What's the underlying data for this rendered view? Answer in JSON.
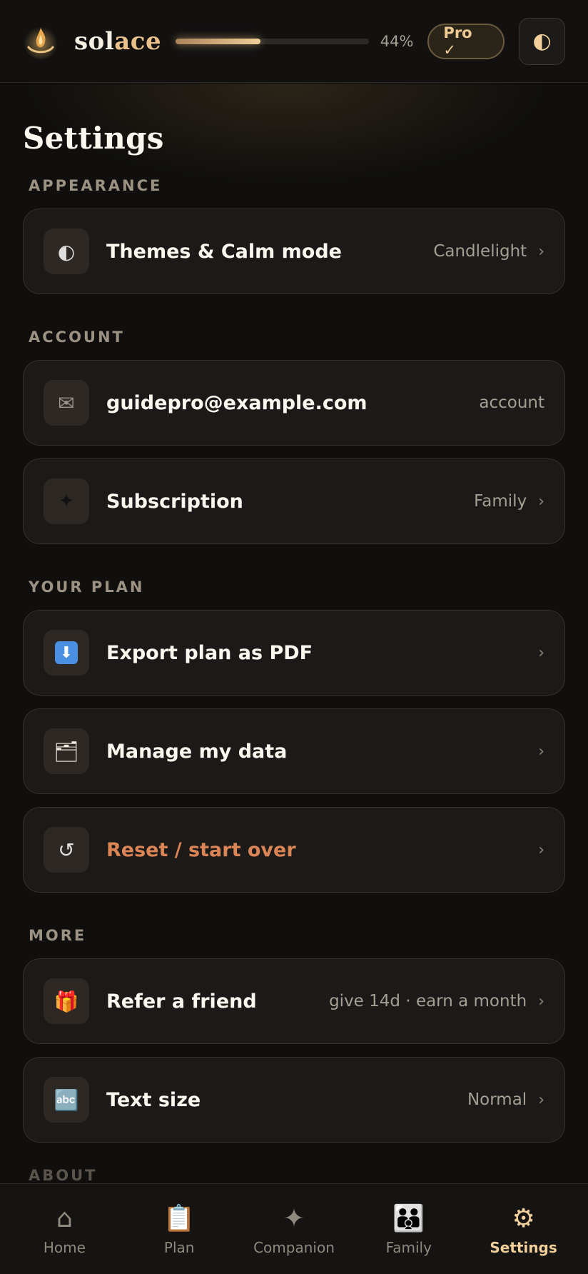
{
  "header": {
    "brand_prefix": "sol",
    "brand_suffix": "ace",
    "progress_percent": 44,
    "progress_text": "44%",
    "pro_label": "Pro ✓",
    "theme_icon": "◐",
    "colors": {
      "accent": "#f0cf9a",
      "background": "#100f0d"
    }
  },
  "page": {
    "title": "Settings"
  },
  "sections": {
    "appearance": {
      "label": "APPEARANCE",
      "themes": {
        "icon": "◐",
        "label": "Themes & Calm mode",
        "value": "Candlelight"
      }
    },
    "account": {
      "label": "ACCOUNT",
      "email": {
        "icon": "✉",
        "label": "guidepro@example.com",
        "value": "account"
      },
      "subscription": {
        "icon": "✦",
        "label": "Subscription",
        "value": "Family"
      }
    },
    "plan": {
      "label": "YOUR PLAN",
      "export": {
        "icon": "⬇",
        "label": "Export plan as PDF"
      },
      "manage": {
        "icon": "🗂",
        "label": "Manage my data"
      },
      "reset": {
        "icon": "↺",
        "label": "Reset / start over"
      }
    },
    "more": {
      "label": "MORE",
      "refer": {
        "icon": "🎁",
        "label": "Refer a friend",
        "value": "give 14d · earn a month"
      },
      "textsize": {
        "icon": "🔤",
        "label": "Text size",
        "value": "Normal"
      }
    },
    "about": {
      "label": "ABOUT"
    }
  },
  "chevron": "›",
  "nav": {
    "home": {
      "icon": "⌂",
      "label": "Home"
    },
    "plan": {
      "icon": "📋",
      "label": "Plan"
    },
    "companion": {
      "icon": "✦",
      "label": "Companion"
    },
    "family": {
      "icon": "👪",
      "label": "Family"
    },
    "settings": {
      "icon": "⚙",
      "label": "Settings",
      "active": true
    }
  }
}
